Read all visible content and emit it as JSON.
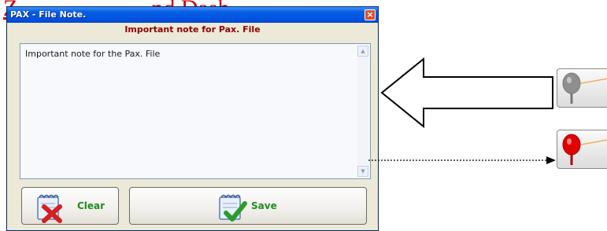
{
  "background": {
    "text_prefix": "Z",
    "text_suffix": "nd Dash"
  },
  "dialog": {
    "title": "PAX - File Note.",
    "close_symbol": "×",
    "heading": "Important note for Pax. File",
    "note_text": "Important note for the Pax. File",
    "clear_label": "Clear",
    "save_label": "Save"
  },
  "icons": {
    "close": "close-icon",
    "clear": "clear-note-icon",
    "save": "save-note-icon",
    "pin_inactive": "pin-grey-icon",
    "pin_active": "pin-red-icon"
  },
  "colors": {
    "title_bar": "#0055e5",
    "heading": "#8b0000",
    "button_label": "#1f8c1f",
    "pin_inactive": "#8a8a8a",
    "pin_active": "#e00000"
  }
}
